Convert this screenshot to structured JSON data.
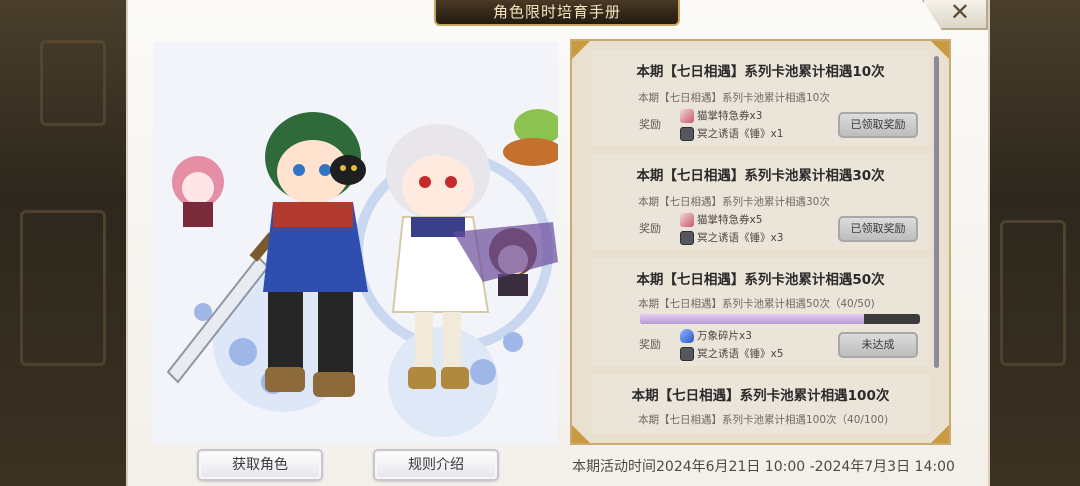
{
  "window": {
    "title": "角色限时培育手册",
    "close_label": "✕"
  },
  "buttons": {
    "get_character": "获取角色",
    "rules": "规则介绍"
  },
  "period": "本期活动时间2024年6月21日 10:00 -2024年7月3日 14:00",
  "reward_label": "奖励",
  "quests": [
    {
      "title": "本期【七日相遇】系列卡池累计相遇10次",
      "subtitle": "本期【七日相遇】系列卡池累计相遇10次",
      "items": [
        {
          "icon": "ticket-icon",
          "text": "猫掌特急券x3"
        },
        {
          "icon": "hammer-icon",
          "text": "冥之诱语《锤》x1"
        }
      ],
      "button": "已领取奖励"
    },
    {
      "title": "本期【七日相遇】系列卡池累计相遇30次",
      "subtitle": "本期【七日相遇】系列卡池累计相遇30次",
      "items": [
        {
          "icon": "ticket-icon",
          "text": "猫掌特急券x5"
        },
        {
          "icon": "hammer-icon",
          "text": "冥之诱语《锤》x3"
        }
      ],
      "button": "已领取奖励"
    },
    {
      "title": "本期【七日相遇】系列卡池累计相遇50次",
      "subtitle": "本期【七日相遇】系列卡池累计相遇50次（40/50)",
      "progress": 0.8,
      "items": [
        {
          "icon": "shard-icon",
          "text": "万象碎片x3"
        },
        {
          "icon": "hammer-icon",
          "text": "冥之诱语《锤》x5"
        }
      ],
      "button": "未达成"
    },
    {
      "title": "本期【七日相遇】系列卡池累计相遇100次",
      "subtitle": "本期【七日相遇】系列卡池累计相遇100次（40/100)"
    }
  ]
}
